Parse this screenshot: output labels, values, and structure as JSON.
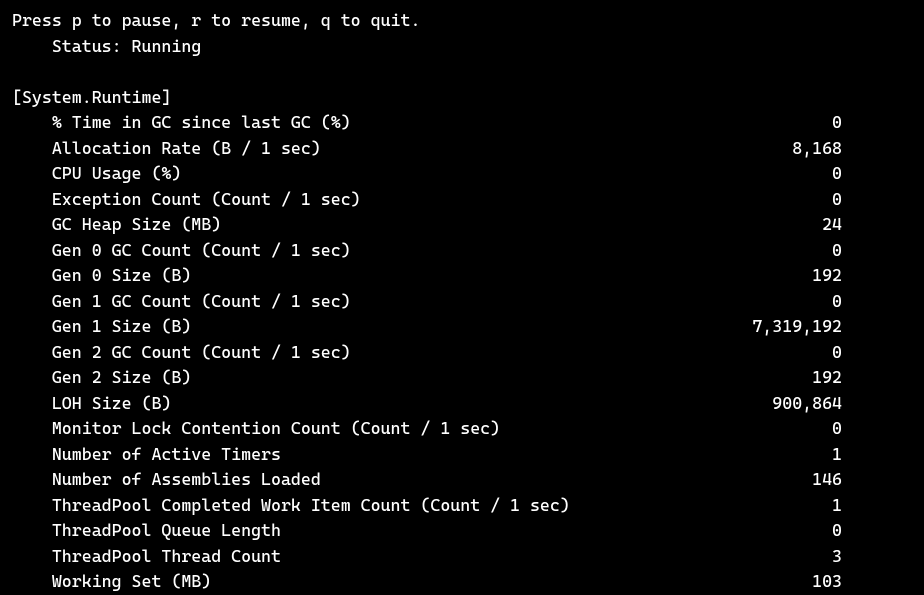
{
  "header": {
    "instructions": "Press p to pause, r to resume, q to quit.",
    "status_label": "Status:",
    "status_value": "Running"
  },
  "section_name": "[System.Runtime]",
  "metrics": [
    {
      "label": "% Time in GC since last GC (%)",
      "value": "0"
    },
    {
      "label": "Allocation Rate (B / 1 sec)",
      "value": "8,168"
    },
    {
      "label": "CPU Usage (%)",
      "value": "0"
    },
    {
      "label": "Exception Count (Count / 1 sec)",
      "value": "0"
    },
    {
      "label": "GC Heap Size (MB)",
      "value": "24"
    },
    {
      "label": "Gen 0 GC Count (Count / 1 sec)",
      "value": "0"
    },
    {
      "label": "Gen 0 Size (B)",
      "value": "192"
    },
    {
      "label": "Gen 1 GC Count (Count / 1 sec)",
      "value": "0"
    },
    {
      "label": "Gen 1 Size (B)",
      "value": "7,319,192"
    },
    {
      "label": "Gen 2 GC Count (Count / 1 sec)",
      "value": "0"
    },
    {
      "label": "Gen 2 Size (B)",
      "value": "192"
    },
    {
      "label": "LOH Size (B)",
      "value": "900,864"
    },
    {
      "label": "Monitor Lock Contention Count (Count / 1 sec)",
      "value": "0"
    },
    {
      "label": "Number of Active Timers",
      "value": "1"
    },
    {
      "label": "Number of Assemblies Loaded",
      "value": "146"
    },
    {
      "label": "ThreadPool Completed Work Item Count (Count / 1 sec)",
      "value": "1"
    },
    {
      "label": "ThreadPool Queue Length",
      "value": "0"
    },
    {
      "label": "ThreadPool Thread Count",
      "value": "3"
    },
    {
      "label": "Working Set (MB)",
      "value": "103"
    }
  ]
}
